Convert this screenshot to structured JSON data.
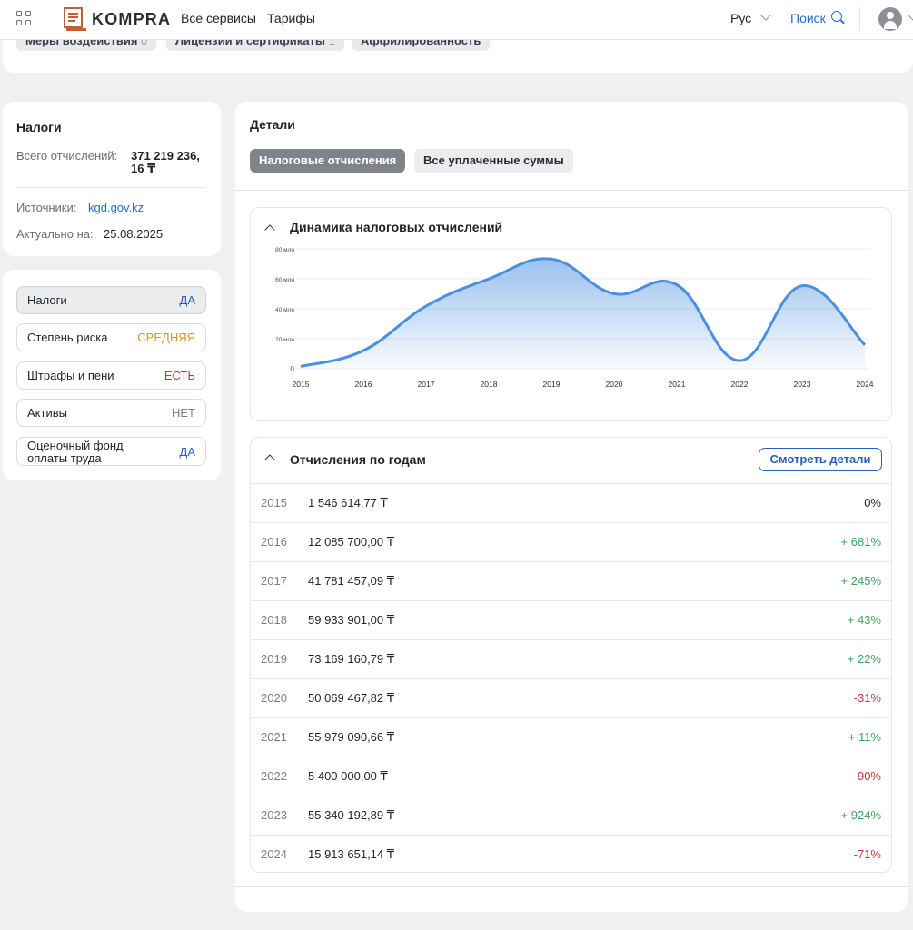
{
  "header": {
    "logo": "KOMPRA",
    "nav": [
      "Все сервисы",
      "Тарифы"
    ],
    "lang": "Рус",
    "search": "Поиск"
  },
  "top_tabs": [
    {
      "label": "Меры воздействия",
      "count": "0"
    },
    {
      "label": "Лицензии и сертификаты",
      "count": "1"
    },
    {
      "label": "Аффилированность",
      "count": ""
    }
  ],
  "taxes": {
    "title": "Налоги",
    "total_label": "Всего отчислений:",
    "total_value_line1": "371 219 236,",
    "total_value_line2": "16 ₸",
    "source_label": "Источники:",
    "source_value": "kgd.gov.kz",
    "date_label": "Актуально на:",
    "date_value": "25.08.2025"
  },
  "statuses": [
    {
      "label": "Налоги",
      "value": "ДА",
      "color": "#2b5fb5"
    },
    {
      "label": "Степень риска",
      "value": "СРЕДНЯЯ",
      "color": "#d9941c"
    },
    {
      "label": "Штрафы и пени",
      "value": "ЕСТЬ",
      "color": "#c8343d"
    },
    {
      "label": "Активы",
      "value": "НЕТ",
      "color": "#7a7e85"
    },
    {
      "label_line1": "Оценочный фонд",
      "label_line2": "оплаты труда",
      "value": "ДА",
      "color": "#2b5fb5"
    }
  ],
  "details": {
    "title": "Детали",
    "tab_active": "Налоговые отчисления",
    "tab_other": "Все уплаченные суммы",
    "chart_title": "Динамика налоговых отчислений",
    "years_title": "Отчисления по годам",
    "details_button": "Смотреть детали"
  },
  "chart_data": {
    "type": "area",
    "x": [
      "2015",
      "2016",
      "2017",
      "2018",
      "2019",
      "2020",
      "2021",
      "2022",
      "2023",
      "2024"
    ],
    "values": [
      1.55,
      12.09,
      41.78,
      59.93,
      73.17,
      50.07,
      55.98,
      5.4,
      55.34,
      15.91
    ],
    "ylim": [
      0,
      80
    ],
    "yticks": [
      "0",
      "20 млн",
      "40 млн",
      "60 млн",
      "80 млн"
    ],
    "ytick_values": [
      0,
      20,
      40,
      60,
      80
    ],
    "grid": true,
    "color": "#4a8fe0"
  },
  "years": [
    {
      "year": "2015",
      "amount": "1 546 614,77 ₸",
      "change": "0%",
      "kind": "neu"
    },
    {
      "year": "2016",
      "amount": "12 085 700,00 ₸",
      "change": "+ 681%",
      "kind": "pos"
    },
    {
      "year": "2017",
      "amount": "41 781 457,09 ₸",
      "change": "+ 245%",
      "kind": "pos"
    },
    {
      "year": "2018",
      "amount": "59 933 901,00 ₸",
      "change": "+ 43%",
      "kind": "pos"
    },
    {
      "year": "2019",
      "amount": "73 169 160,79 ₸",
      "change": "+ 22%",
      "kind": "pos"
    },
    {
      "year": "2020",
      "amount": "50 069 467,82 ₸",
      "change": "-31%",
      "kind": "neg"
    },
    {
      "year": "2021",
      "amount": "55 979 090,66 ₸",
      "change": "+ 11%",
      "kind": "pos"
    },
    {
      "year": "2022",
      "amount": "5 400 000,00 ₸",
      "change": "-90%",
      "kind": "neg"
    },
    {
      "year": "2023",
      "amount": "55 340 192,89 ₸",
      "change": "+ 924%",
      "kind": "pos"
    },
    {
      "year": "2024",
      "amount": "15 913 651,14 ₸",
      "change": "-71%",
      "kind": "neg"
    }
  ]
}
